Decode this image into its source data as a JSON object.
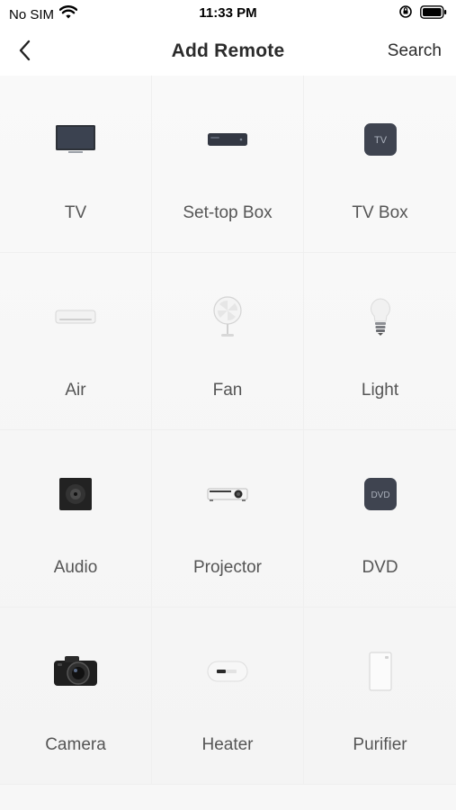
{
  "status": {
    "carrier": "No SIM",
    "time": "11:33 PM"
  },
  "nav": {
    "title": "Add Remote",
    "search_label": "Search"
  },
  "devices": [
    {
      "label": "TV",
      "icon": "tv-icon"
    },
    {
      "label": "Set-top Box",
      "icon": "set-top-box-icon"
    },
    {
      "label": "TV Box",
      "icon": "tv-box-icon",
      "badge": "TV"
    },
    {
      "label": "Air",
      "icon": "air-conditioner-icon"
    },
    {
      "label": "Fan",
      "icon": "fan-icon"
    },
    {
      "label": "Light",
      "icon": "light-bulb-icon"
    },
    {
      "label": "Audio",
      "icon": "speaker-icon"
    },
    {
      "label": "Projector",
      "icon": "projector-icon"
    },
    {
      "label": "DVD",
      "icon": "dvd-icon",
      "badge": "DVD"
    },
    {
      "label": "Camera",
      "icon": "camera-icon"
    },
    {
      "label": "Heater",
      "icon": "heater-icon"
    },
    {
      "label": "Purifier",
      "icon": "purifier-icon"
    }
  ]
}
